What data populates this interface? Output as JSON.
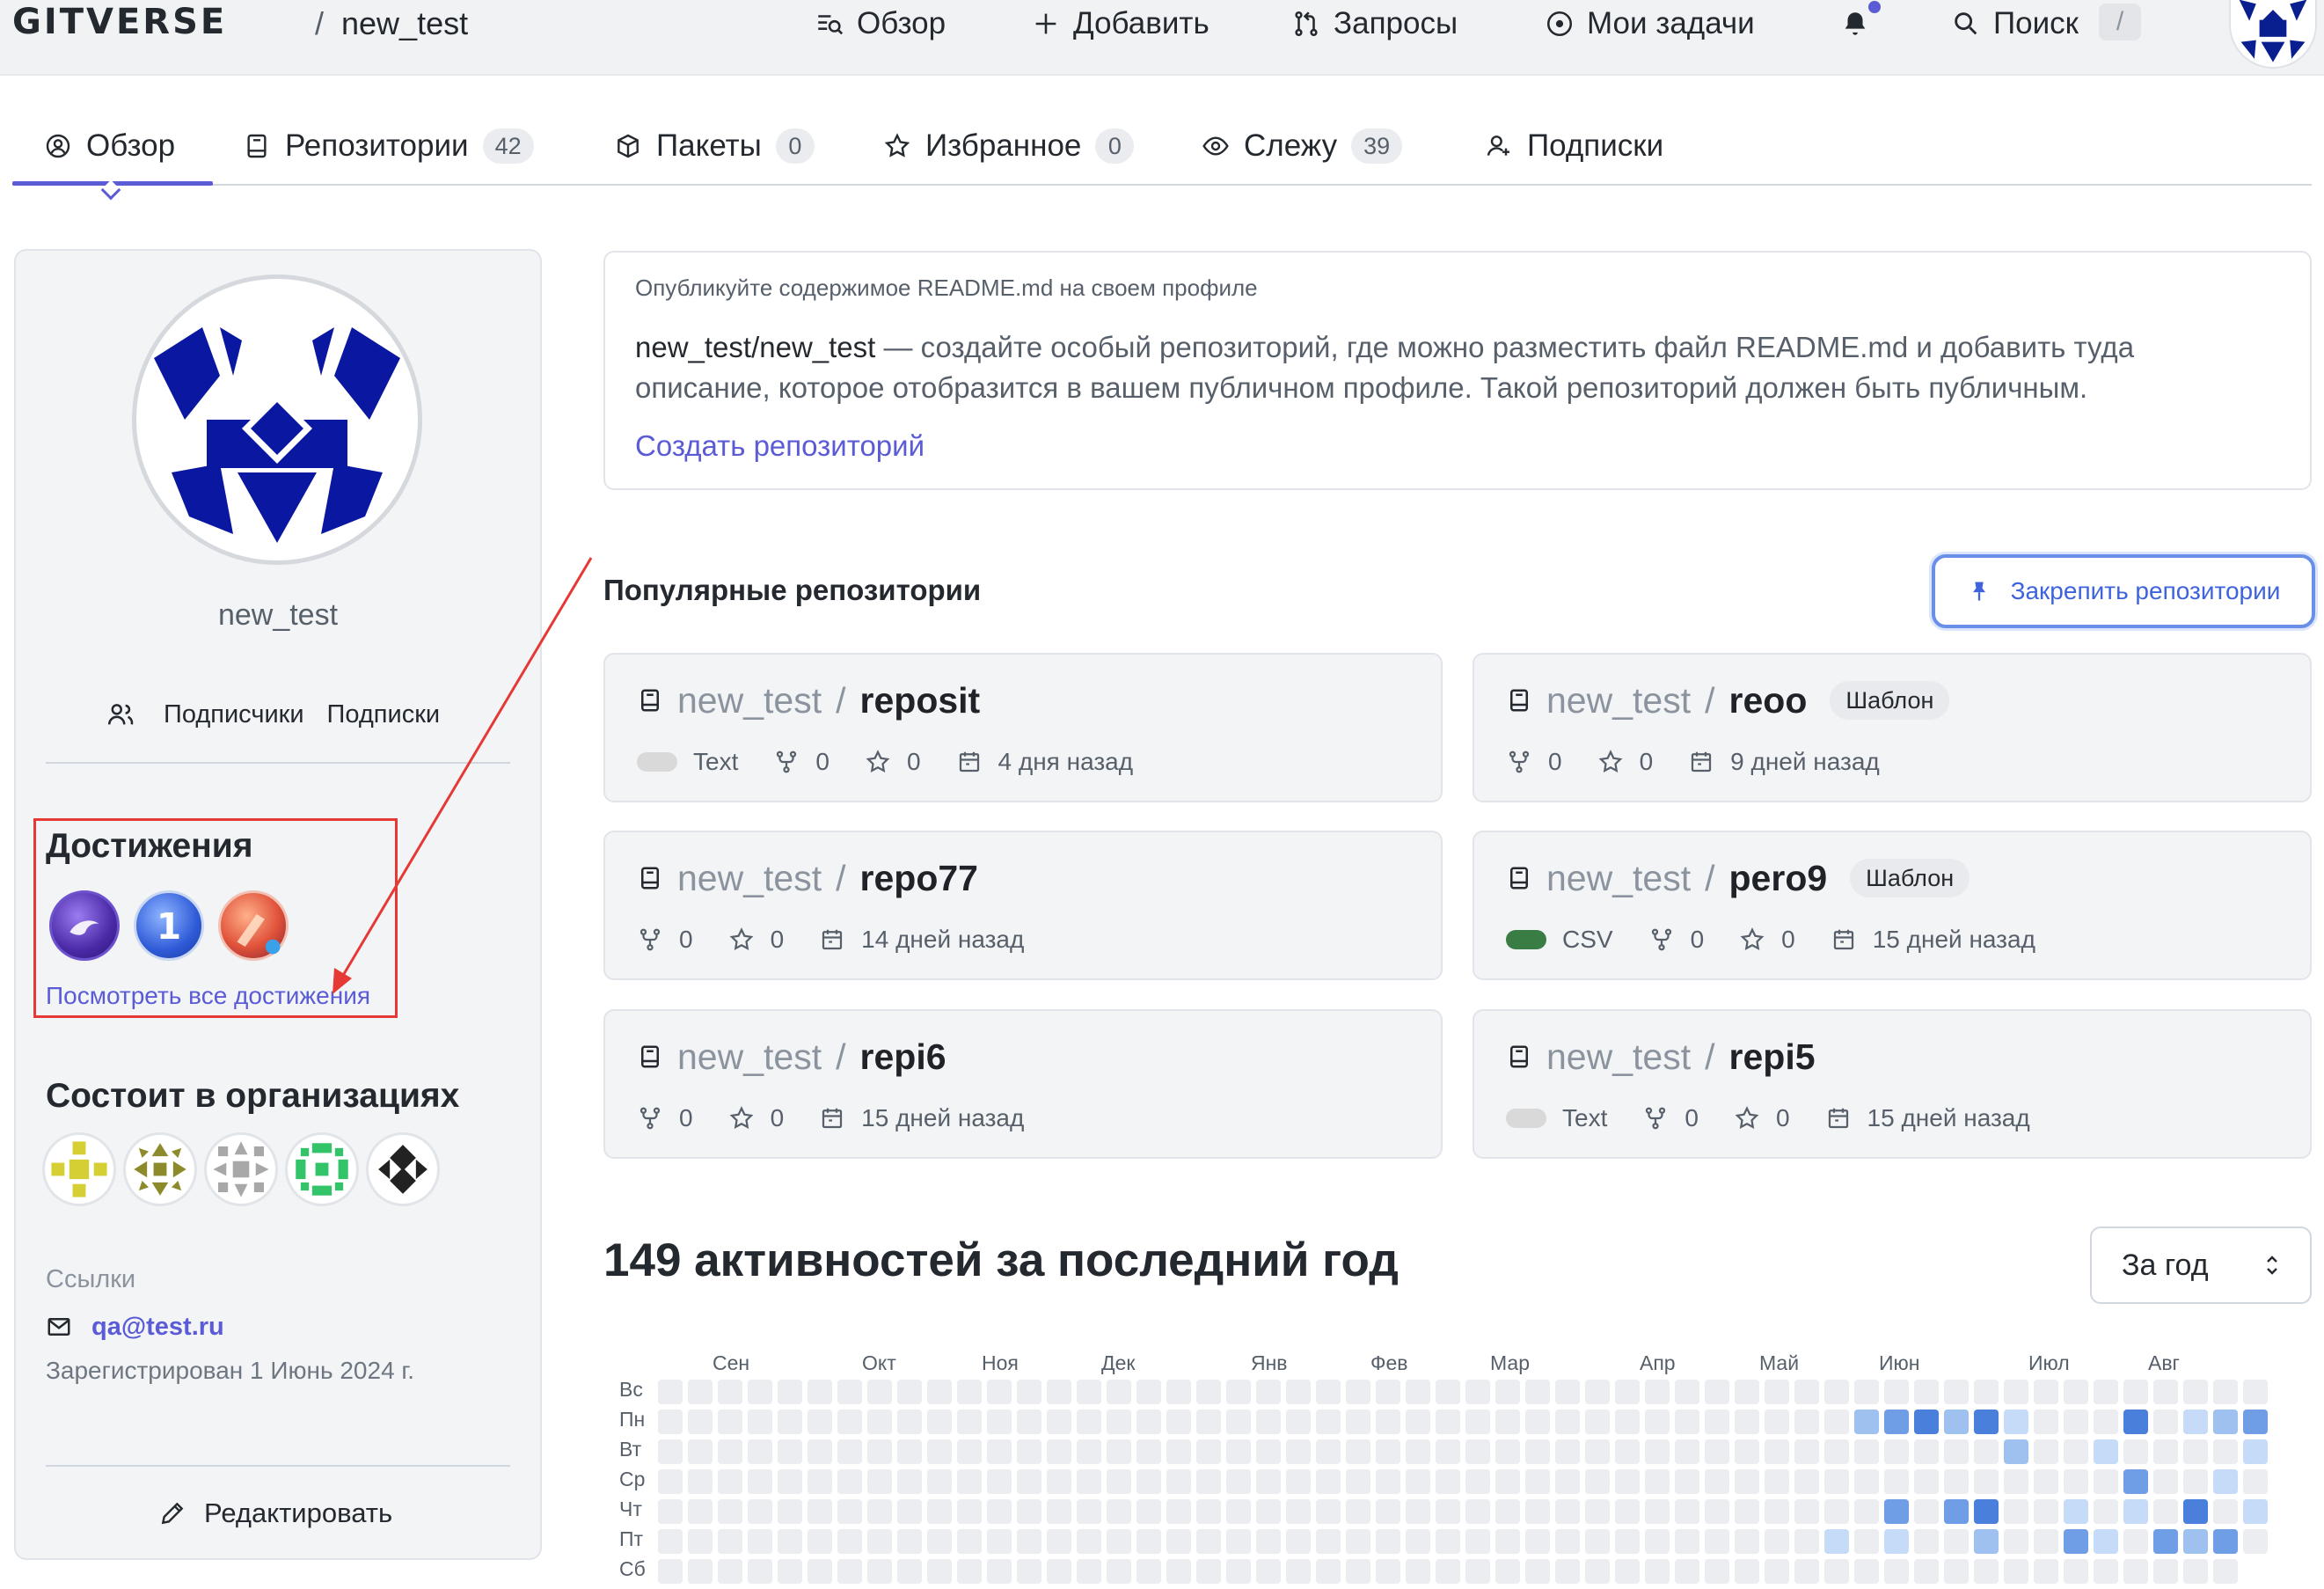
{
  "header": {
    "logo": "GITVERSE",
    "separator": "/",
    "current_user": "new_test",
    "nav": {
      "overview": "Обзор",
      "add": "Добавить",
      "requests": "Запросы",
      "my_tasks": "Мои задачи",
      "search": "Поиск",
      "search_shortcut": "/"
    }
  },
  "tabs": [
    {
      "label": "Обзор"
    },
    {
      "label": "Репозитории",
      "count": "42"
    },
    {
      "label": "Пакеты",
      "count": "0"
    },
    {
      "label": "Избранное",
      "count": "0"
    },
    {
      "label": "Слежу",
      "count": "39"
    },
    {
      "label": "Подписки"
    }
  ],
  "profile": {
    "username": "new_test",
    "followers_label": "Подписчики",
    "following_label": "Подписки",
    "achievements_title": "Достижения",
    "achievements_link": "Посмотреть все достижения",
    "orgs_title": "Состоит в организациях",
    "links_label": "Ссылки",
    "email": "qa@test.ru",
    "registered": "Зарегистрирован 1 Июнь 2024 г.",
    "edit_label": "Редактировать"
  },
  "readme": {
    "hint": "Опубликуйте содержимое README.md на своем профиле",
    "repo_path": "new_test/new_test",
    "description": " — создайте особый репозиторий, где можно разместить файл README.md и добавить туда описание, которое отобразится в вашем публичном профиле. Такой репозиторий должен быть публичным.",
    "create_link": "Создать репозиторий"
  },
  "popular": {
    "title": "Популярные репозитории",
    "pin_button": "Закрепить репозитории",
    "template_badge": "Шаблон",
    "repos": [
      {
        "owner": "new_test",
        "sep": "/",
        "name": "reposit",
        "lang": "Text",
        "forks": "0",
        "stars": "0",
        "updated": "4 дня назад"
      },
      {
        "owner": "new_test",
        "sep": "/",
        "name": "reoo",
        "forks": "0",
        "stars": "0",
        "updated": "9 дней назад"
      },
      {
        "owner": "new_test",
        "sep": "/",
        "name": "repo77",
        "forks": "0",
        "stars": "0",
        "updated": "14 дней назад"
      },
      {
        "owner": "new_test",
        "sep": "/",
        "name": "pero9",
        "lang": "CSV",
        "forks": "0",
        "stars": "0",
        "updated": "15 дней назад"
      },
      {
        "owner": "new_test",
        "sep": "/",
        "name": "repi6",
        "forks": "0",
        "stars": "0",
        "updated": "15 дней назад"
      },
      {
        "owner": "new_test",
        "sep": "/",
        "name": "repi5",
        "lang": "Text",
        "forks": "0",
        "stars": "0",
        "updated": "15 дней назад"
      }
    ],
    "lang_colors": {
      "Text": "#d9d9d9",
      "CSV": "#3a7d44"
    }
  },
  "activity": {
    "title": "149 активностей за последний год",
    "period": "За год",
    "months": [
      "Сен",
      "Окт",
      "Ноя",
      "Дек",
      "Янв",
      "Фев",
      "Мар",
      "Апр",
      "Май",
      "Июн",
      "Июл",
      "Авг"
    ],
    "days": [
      "Вс",
      "Пн",
      "Вт",
      "Ср",
      "Чт",
      "Пт",
      "Сб"
    ],
    "colors": [
      "#ebedf0",
      "#c6dbf7",
      "#9ec1f0",
      "#6f9ee6",
      "#4a7fdb"
    ],
    "levels": {
      "Пн": {
        "40": 2,
        "41": 3,
        "42": 4,
        "43": 2,
        "44": 4,
        "45": 1,
        "49": 4,
        "51": 1,
        "52": 2,
        "53": 3
      },
      "Вт": {
        "45": 2,
        "48": 1,
        "53": 1
      },
      "Ср": {
        "49": 3,
        "52": 1
      },
      "Чт": {
        "41": 3,
        "43": 3,
        "44": 4,
        "47": 1,
        "49": 1,
        "51": 4,
        "53": 1
      },
      "Пт": {
        "39": 1,
        "41": 1,
        "44": 2,
        "47": 3,
        "48": 1,
        "50": 3,
        "51": 2,
        "52": 3
      },
      "Сб": {}
    }
  }
}
